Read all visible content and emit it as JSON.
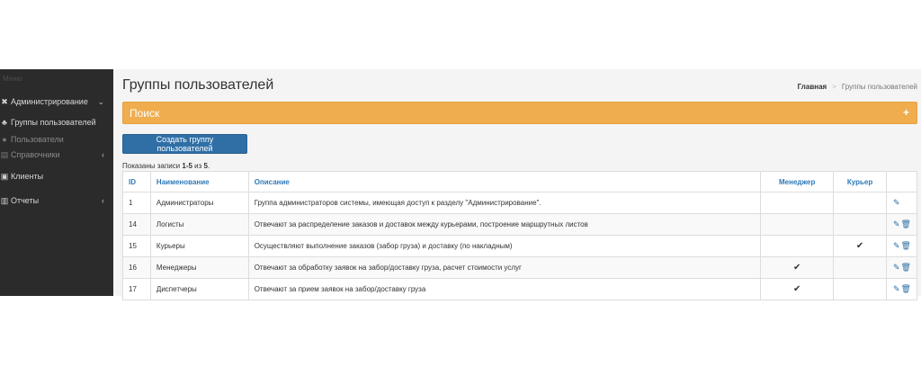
{
  "sidebar": {
    "menu_label": "Меню",
    "items": [
      {
        "label": "Администрирование",
        "icon": "wrench-icon",
        "has_chevron": true
      },
      {
        "label": "Группы пользователей",
        "icon": "users-icon"
      },
      {
        "label": "Пользователи",
        "icon": "user-icon"
      },
      {
        "label": "Справочники",
        "icon": "book-icon",
        "has_chevron": true
      },
      {
        "label": "Клиенты",
        "icon": "clients-icon"
      },
      {
        "label": "Отчеты",
        "icon": "reports-icon",
        "has_chevron": true
      }
    ]
  },
  "page": {
    "title": "Группы пользователей",
    "breadcrumb": [
      "Главная",
      ">",
      "Группы пользователей"
    ]
  },
  "search": {
    "title": "Поиск",
    "plus": "+"
  },
  "toolbar": {
    "create_label": "Создать группу пользователей"
  },
  "records": {
    "prefix": "Показаны записи",
    "range": "1-5",
    "mid": "из",
    "total": "5"
  },
  "table": {
    "headers": [
      "ID",
      "Наименование",
      "Описание",
      "Менеджер",
      "Курьер",
      ""
    ],
    "rows": [
      {
        "id": "1",
        "name": "Администраторы",
        "desc": "Группа администраторов системы, имеющая доступ к разделу \"Администрирование\".",
        "manager": "",
        "courier": "",
        "edit": true,
        "delete": false
      },
      {
        "id": "14",
        "name": "Логисты",
        "desc": "Отвечают за распределение заказов и доставок между курьерами, построение маршрутных листов",
        "manager": "",
        "courier": "",
        "edit": true,
        "delete": true
      },
      {
        "id": "15",
        "name": "Курьеры",
        "desc": "Осуществляют выполнение заказов (забор груза) и доставку (по накладным)",
        "manager": "",
        "courier": "✔",
        "edit": true,
        "delete": true
      },
      {
        "id": "16",
        "name": "Менеджеры",
        "desc": "Отвечают за обработку заявок на забор/доставку груза, расчет стоимости услуг",
        "manager": "✔",
        "courier": "",
        "edit": true,
        "delete": true
      },
      {
        "id": "17",
        "name": "Диспетчеры",
        "desc": "Отвечают за прием заявок на забор/доставку груза",
        "manager": "✔",
        "courier": "",
        "edit": true,
        "delete": true
      }
    ]
  },
  "colors": {
    "sidebar_bg": "#2b2b2b",
    "search_bar": "#f0ad4e",
    "primary_button": "#2f6fa6",
    "link_blue": "#2f7ab8"
  }
}
